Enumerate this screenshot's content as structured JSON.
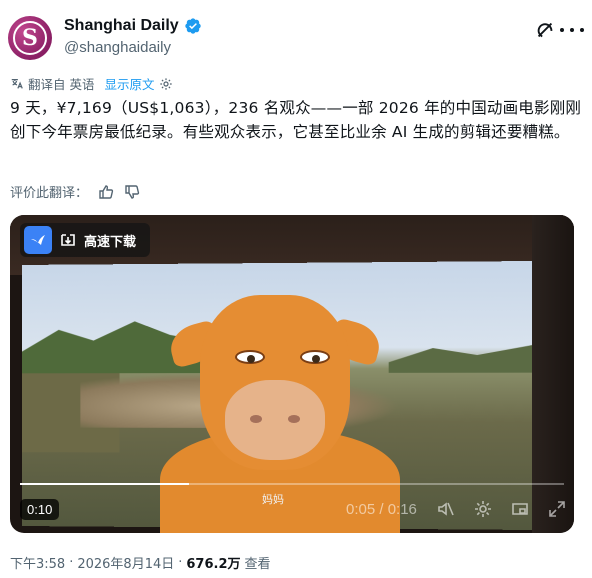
{
  "author": {
    "display_name": "Shanghai Daily",
    "handle": "@shanghaidaily",
    "avatar_letter": "S",
    "verified": true
  },
  "translation": {
    "label": "翻译自 英语",
    "show_original": "显示原文"
  },
  "post": {
    "text": "9 天，¥7,169（US$1,063），236 名观众——一部 2026 年的中国动画电影刚刚创下今年票房最低纪录。有些观众表示，它甚至比业余 AI 生成的剪辑还要糟糕。"
  },
  "rating": {
    "label": "评价此翻译："
  },
  "media": {
    "download_label": "高速下载",
    "subtitle": "妈妈",
    "duration_badge": "0:10",
    "player_time": "0:05 / 0:16",
    "progress": 0.31
  },
  "meta": {
    "time": "下午3:58",
    "separator": "·",
    "date": "2026年8月14日",
    "views": "676.2万",
    "views_label": "查看"
  },
  "colors": {
    "accent": "#1d9bf0",
    "text": "#0f1419",
    "secondary": "#536471"
  }
}
